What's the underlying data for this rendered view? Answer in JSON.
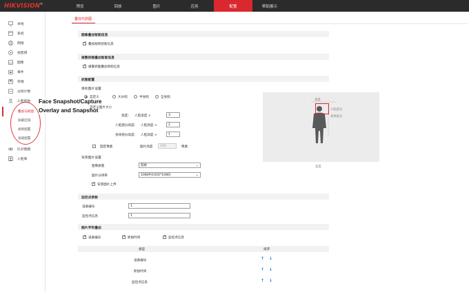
{
  "brand": {
    "logo": "HIKVISION",
    "reg": "®"
  },
  "nav": [
    {
      "label": "预览"
    },
    {
      "label": "回放"
    },
    {
      "label": "图片"
    },
    {
      "label": "应用"
    },
    {
      "label": "配置"
    },
    {
      "label": "帮助展示"
    }
  ],
  "sidebar": {
    "items": [
      {
        "label": "本地",
        "icon": "monitor-icon"
      },
      {
        "label": "系统",
        "icon": "system-icon"
      },
      {
        "label": "网络",
        "icon": "globe-icon"
      },
      {
        "label": "视音频",
        "icon": "video-icon"
      },
      {
        "label": "图像",
        "icon": "image-icon"
      },
      {
        "label": "事件",
        "icon": "calendar-icon"
      },
      {
        "label": "存储",
        "icon": "storage-icon"
      },
      {
        "label": "过线计数",
        "icon": "counter-icon"
      },
      {
        "label": "人脸抓拍",
        "icon": "face-icon"
      }
    ],
    "sub_items": [
      {
        "label": "叠加与抓图"
      },
      {
        "label": "屏蔽区域"
      },
      {
        "label": "规则配置"
      },
      {
        "label": "高级配置"
      }
    ],
    "items_after": [
      {
        "label": "比对建模",
        "icon": "model-icon"
      },
      {
        "label": "人脸库",
        "icon": "person-icon"
      }
    ]
  },
  "annotation": {
    "line1": "Face Snapshot/Capture",
    "line2": "Overlay and Snapshot"
  },
  "page": {
    "tab": "叠加与抓图",
    "sec_overlay": "图像叠加智能信息",
    "cb_overlay": "叠加规则智能信息",
    "sec_alarm": "报警抓图叠加智能信息",
    "cb_alarm": "报警抓图叠加目标信息",
    "sec_snapshot": "抓图配置",
    "sub_target": "目标图片设置",
    "radios": [
      "自定义",
      "大头照",
      "半身照",
      "全身照"
    ],
    "custom_size": "自定义图片大小",
    "width_label": "宽度：",
    "face_w_label": "人脸宽度 ×",
    "face_w_val": "3",
    "face_h_label_left": "人脸部分高度:",
    "face_h_label": "人脸高度 ×",
    "face_h_val": "2",
    "body_h_label_left": "身体部分高度:",
    "body_h_label": "人脸高度 ×",
    "body_h_val": "1",
    "fixed_label": "固定像素",
    "pic_height_label": "图片高度",
    "pic_height_val": "100",
    "pixel_unit": "像素",
    "sub_bg": "背景图片设置",
    "img_quality_label": "图像质量",
    "img_quality_val": "较好",
    "resolution_label": "图片分辨率",
    "resolution_val": "1080P(1920*1080)",
    "cb_bg_upload": "背景图片上传",
    "sec_monitor": "监控点参数",
    "device_no_label": "设备编号",
    "device_no_val": "1",
    "monitor_info_label": "监控点信息",
    "monitor_info_val": "1",
    "sec_text": "图片字符叠加",
    "cb_text": [
      "设备编号",
      "抓拍时间",
      "监控点信息"
    ],
    "table_headers": {
      "type": "类型",
      "sort": "排序"
    },
    "table_rows": [
      {
        "type": "设备编号"
      },
      {
        "type": "抓拍时间"
      },
      {
        "type": "监控点信息"
      }
    ],
    "arrows": {
      "up": "↑",
      "down": "↓"
    }
  },
  "preview": {
    "caption_width": "宽度",
    "caption_face": "人脸部分",
    "caption_body": "身体部分",
    "caption_height": "高度"
  }
}
